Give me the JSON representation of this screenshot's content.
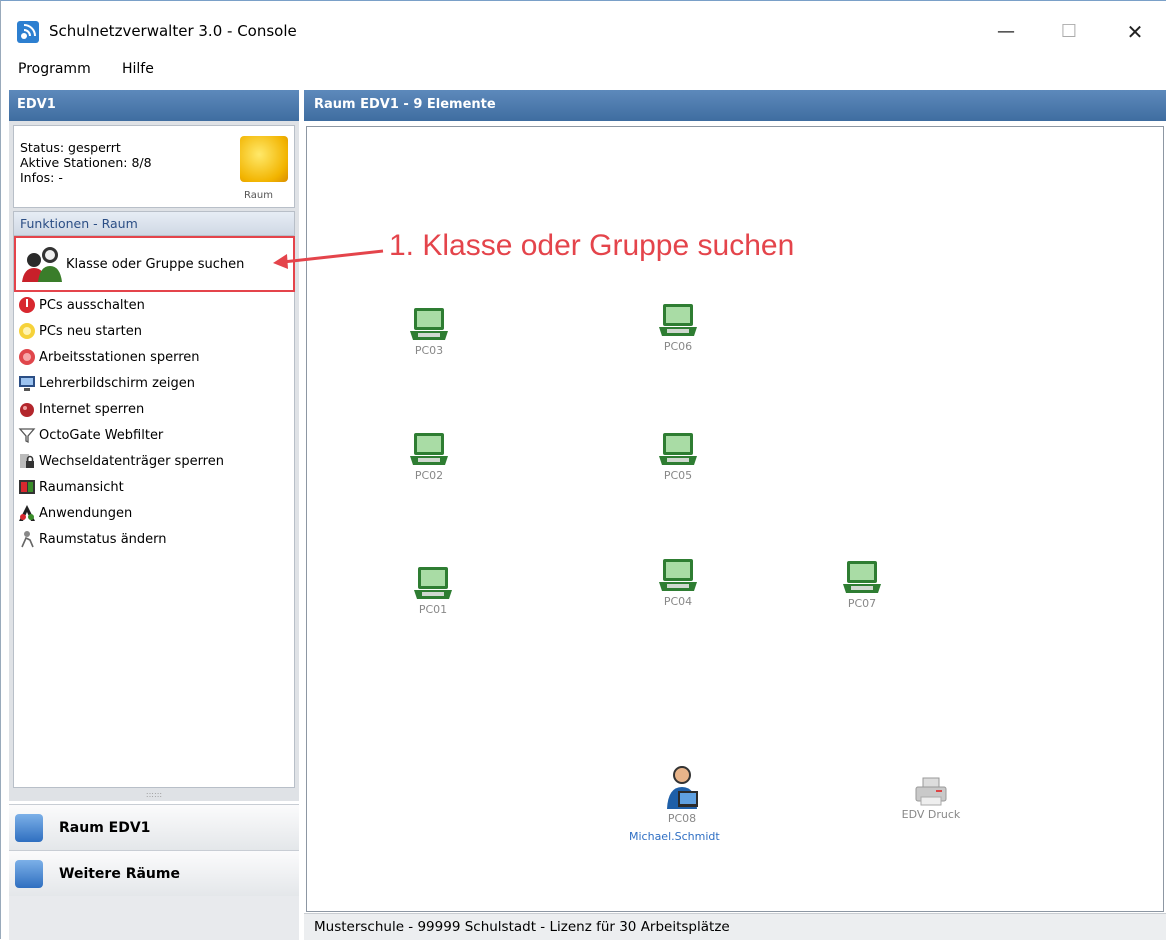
{
  "window": {
    "title": "Schulnetzverwalter 3.0 - Console",
    "controls": {
      "minimize": "—",
      "maximize": "☐",
      "close": "✕"
    }
  },
  "menu": [
    {
      "label": "Programm"
    },
    {
      "label": "Hilfe"
    }
  ],
  "left_panel": {
    "header": "EDV1",
    "info": {
      "status": "Status: gesperrt",
      "active": "Aktive Stationen: 8/8",
      "infos": "Infos: -",
      "icon_label": "Raum"
    },
    "functions_header": "Funktionen - Raum",
    "functions": [
      {
        "label": "Klasse oder Gruppe suchen",
        "icon": "group-search-icon"
      },
      {
        "label": "PCs ausschalten",
        "icon": "power-off-icon"
      },
      {
        "label": "PCs neu starten",
        "icon": "restart-icon"
      },
      {
        "label": "Arbeitsstationen sperren",
        "icon": "lock-workstation-icon"
      },
      {
        "label": "Lehrerbildschirm zeigen",
        "icon": "show-screen-icon"
      },
      {
        "label": "Internet sperren",
        "icon": "internet-block-icon"
      },
      {
        "label": "OctoGate Webfilter",
        "icon": "filter-icon"
      },
      {
        "label": "Wechseldatenträger sperren",
        "icon": "removable-lock-icon"
      },
      {
        "label": "Raumansicht",
        "icon": "room-view-icon"
      },
      {
        "label": "Anwendungen",
        "icon": "applications-icon"
      },
      {
        "label": "Raumstatus ändern",
        "icon": "room-status-icon"
      }
    ],
    "grip": "::::::",
    "nav": [
      {
        "label": "Raum EDV1",
        "icon": "room-nav-icon"
      },
      {
        "label": "Weitere Räume",
        "icon": "more-rooms-icon"
      }
    ]
  },
  "right_panel": {
    "header": "Raum EDV1 - 9 Elemente",
    "stations": [
      {
        "name": "PC03"
      },
      {
        "name": "PC06"
      },
      {
        "name": "PC02"
      },
      {
        "name": "PC05"
      },
      {
        "name": "PC01"
      },
      {
        "name": "PC04"
      },
      {
        "name": "PC07"
      }
    ],
    "teacher": {
      "name": "PC08",
      "user": "Michael.Schmidt"
    },
    "printer": {
      "name": "EDV Druck"
    }
  },
  "status_bar": "Musterschule - 99999 Schulstadt - Lizenz für 30 Arbeitsplätze",
  "annotation": {
    "text": "1. Klasse oder Gruppe suchen",
    "color": "#e4444b"
  }
}
